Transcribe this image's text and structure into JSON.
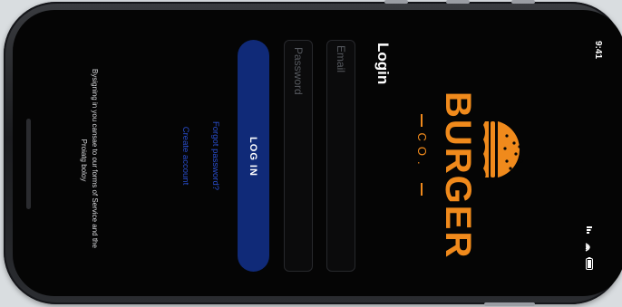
{
  "status_bar": {
    "time": "9:41",
    "icons": [
      "signal-icon",
      "wifi-icon",
      "battery-icon"
    ]
  },
  "brand": {
    "name": "BURGER",
    "sub": "CO.",
    "icon": "burger-icon",
    "color": "#f08a1c"
  },
  "login": {
    "title": "Login",
    "email_placeholder": "Email",
    "password_placeholder": "Password",
    "button_label": "LOG IN",
    "forgot_link": "Forgot password?",
    "create_link": "Create account",
    "terms_line1": "Bysigning in you cansae to our forms of Service and the",
    "terms_line2": "Proiatg boloy",
    "accent_color": "#102a78",
    "link_color": "#2a4fd0"
  }
}
